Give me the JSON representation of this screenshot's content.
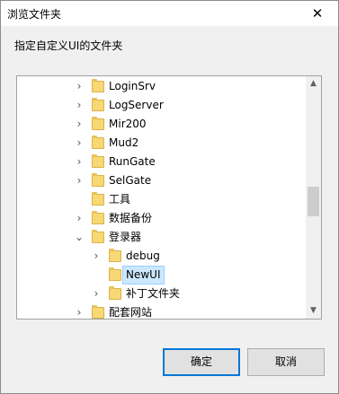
{
  "window": {
    "title": "浏览文件夹",
    "close_symbol": "✕"
  },
  "instruction": "指定自定义UI的文件夹",
  "tree": {
    "items": [
      {
        "label": "LoginSrv",
        "expander": "›"
      },
      {
        "label": "LogServer",
        "expander": "›"
      },
      {
        "label": "Mir200",
        "expander": "›"
      },
      {
        "label": "Mud2",
        "expander": "›"
      },
      {
        "label": "RunGate",
        "expander": "›"
      },
      {
        "label": "SelGate",
        "expander": "›"
      },
      {
        "label": "工具",
        "expander": ""
      },
      {
        "label": "数据备份",
        "expander": "›"
      },
      {
        "label": "登录器",
        "expander": "⌄"
      },
      {
        "label": "debug",
        "expander": "›"
      },
      {
        "label": "NewUI",
        "expander": "",
        "selected": true
      },
      {
        "label": "补丁文件夹",
        "expander": "›"
      },
      {
        "label": "配套网站",
        "expander": "›"
      }
    ]
  },
  "scrollbar": {
    "up_arrow": "▲",
    "down_arrow": "▼"
  },
  "buttons": {
    "ok": "确定",
    "cancel": "取消"
  },
  "colors": {
    "selection_bg": "#cce8ff",
    "selection_border": "#99d1ff",
    "default_button_border": "#0078d7",
    "folder": "#f8d775"
  }
}
